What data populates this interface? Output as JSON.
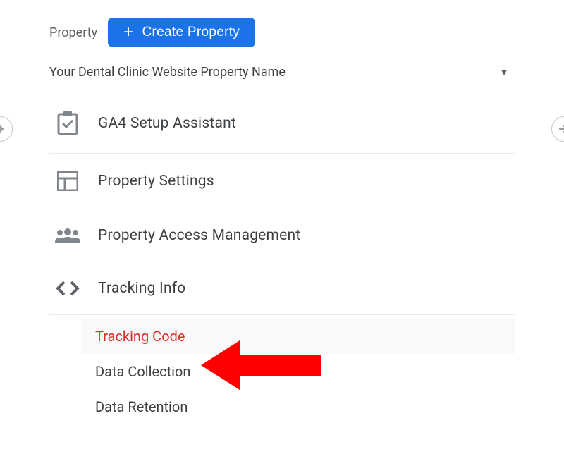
{
  "header": {
    "propertyLabel": "Property",
    "createButton": "Create Property"
  },
  "propertySelector": {
    "name": "Your Dental Clinic Website Property Name"
  },
  "menu": {
    "items": [
      {
        "label": "GA4 Setup Assistant"
      },
      {
        "label": "Property Settings"
      },
      {
        "label": "Property Access Management"
      },
      {
        "label": "Tracking Info",
        "subitems": [
          {
            "label": "Tracking Code",
            "active": true
          },
          {
            "label": "Data Collection"
          },
          {
            "label": "Data Retention"
          }
        ]
      }
    ]
  }
}
